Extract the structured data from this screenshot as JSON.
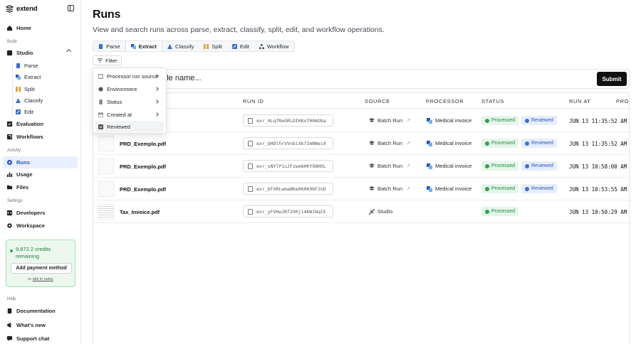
{
  "brand": "extend",
  "sidebar": {
    "home": "Home",
    "build_label": "Build",
    "studio": "Studio",
    "studio_items": [
      "Parse",
      "Extract",
      "Split",
      "Classify",
      "Edit"
    ],
    "evaluation": "Evaluation",
    "workflows": "Workflows",
    "activity_label": "Activity",
    "runs": "Runs",
    "usage": "Usage",
    "files": "Files",
    "settings_label": "Settings",
    "developers": "Developers",
    "workspace": "Workspace",
    "credits_amount": "9,872.2 credits remaining",
    "add_payment": "Add payment method",
    "talk_prefix": "or",
    "talk_link": "talk to sales",
    "help_label": "Help",
    "documentation": "Documentation",
    "whats_new": "What's new",
    "support": "Support chat"
  },
  "page": {
    "title": "Runs",
    "subtitle": "View and search runs across parse, extract, classify, split, edit, and workflow operations."
  },
  "tabs": [
    "Parse",
    "Extract",
    "Classify",
    "Split",
    "Edit",
    "Workflow"
  ],
  "active_tab": "Extract",
  "filter_label": "Filter",
  "search": {
    "visible_text": "r file name..."
  },
  "submit_label": "Submit",
  "filter_menu": [
    "Processor run source",
    "Environment",
    "Status",
    "Created at",
    "Reviewed"
  ],
  "table": {
    "headers": [
      "RUN ID",
      "SOURCE",
      "PROCESSOR",
      "STATUS",
      "RUN AT",
      "PROC"
    ],
    "rows": [
      {
        "file": "",
        "run_id": "exr_4LqfReGRLOIKKoT00AOba",
        "source": "Batch Run",
        "processor": "Medical invoice",
        "status": "Processed",
        "review": "Reviewed",
        "run_at": "JUN 13  11:35:52 AM"
      },
      {
        "file": "PRD_Exemplo.pdf",
        "run_id": "exr_QHDlhrVVnbiXk7ImNNei9",
        "source": "Batch Run",
        "processor": "Medical invoice",
        "status": "Processed",
        "review": "Reviewed",
        "run_at": "JUN 13  11:35:52 AM"
      },
      {
        "file": "PRD_Exemplo.pdf",
        "run_id": "exr_sNYlP1uJFzwe6HKY98KKL",
        "source": "Batch Run",
        "processor": "Medical invoice",
        "status": "Processed",
        "review": "Reviewed",
        "run_at": "JUN 13  10:58:00 AM"
      },
      {
        "file": "PRD_Exemplo.pdf",
        "run_id": "exr_bFXRLwmaBKe060K9bF2nD",
        "source": "Batch Run",
        "processor": "Medical invoice",
        "status": "Processed",
        "review": "Reviewed",
        "run_at": "JUN 13  10:53:55 AM"
      },
      {
        "file": "Tax_Invoice.pdf",
        "run_id": "exr_yFVHwJRf290ji4KWiNqlE",
        "source": "Studio",
        "processor": "",
        "status": "Processed",
        "review": "",
        "run_at": "JUN 13  10:50:29 AM"
      }
    ]
  },
  "colors": {
    "accent": "#2a56c6",
    "processed": "#1f8a3d",
    "submit": "#111111"
  }
}
